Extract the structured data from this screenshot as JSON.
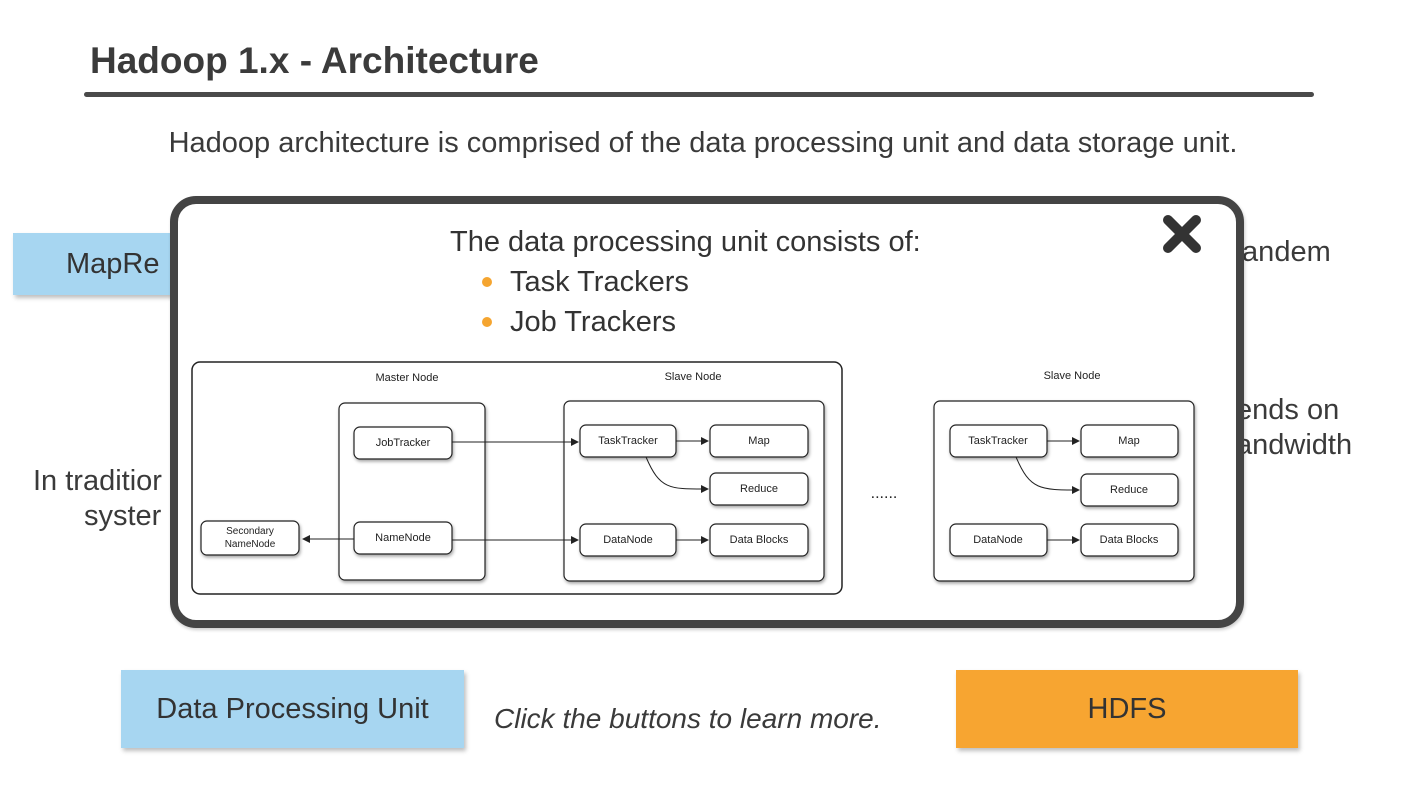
{
  "slide": {
    "title": "Hadoop 1.x - Architecture",
    "subtitle": "Hadoop architecture is comprised of the data processing unit and data storage unit."
  },
  "background": {
    "mapreduce_button_label": "MapRe",
    "right_text_1": "tandem",
    "right_text_2": "ends on",
    "right_text_3": "andwidth",
    "left_text_1": "In traditior",
    "left_text_2": "syster"
  },
  "popup": {
    "heading": "The data processing unit consists of:",
    "bullets": [
      "Task Trackers",
      "Job Trackers"
    ],
    "diagram": {
      "master_node_title": "Master Node",
      "slave_node_title": "Slave Node",
      "slave_node_title_2": "Slave Node",
      "job_tracker": "JobTracker",
      "name_node": "NameNode",
      "secondary_name_node_line1": "Secondary",
      "secondary_name_node_line2": "NameNode",
      "task_tracker": "TaskTracker",
      "map": "Map",
      "reduce": "Reduce",
      "data_node": "DataNode",
      "data_blocks": "Data Blocks",
      "ellipsis": "......"
    }
  },
  "buttons": {
    "data_processing_unit": "Data Processing Unit",
    "hdfs": "HDFS"
  },
  "hint": "Click the buttons to learn more.",
  "colors": {
    "blue_button": "#a7d6f1",
    "orange_button": "#f7a531",
    "bullet": "#f5a530"
  }
}
